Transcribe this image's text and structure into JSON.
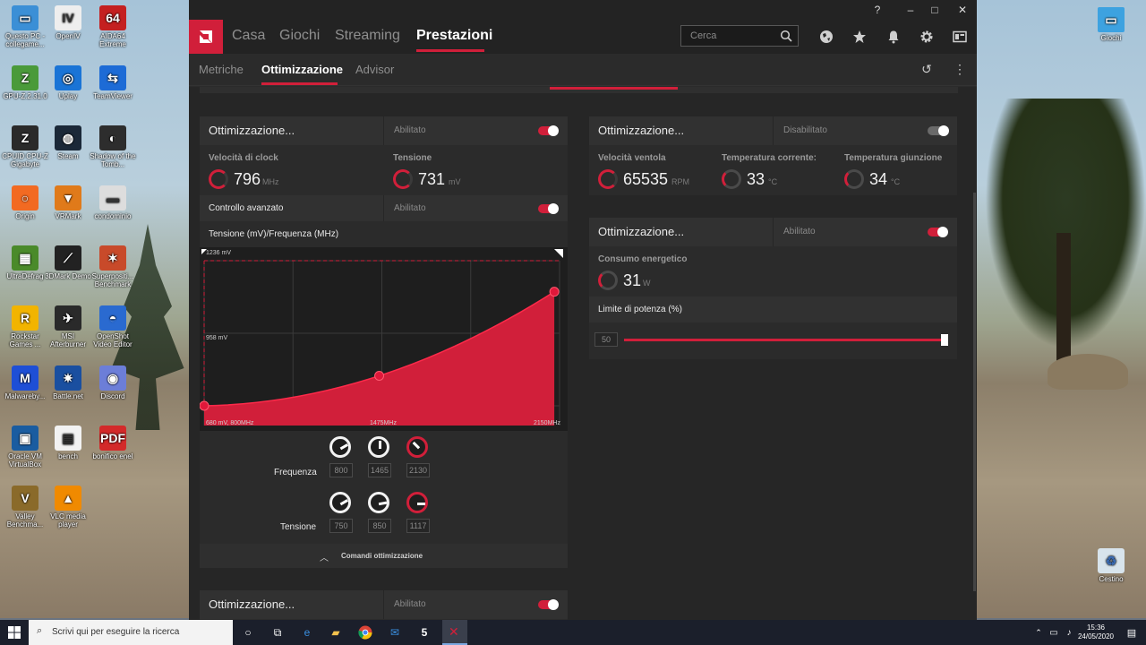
{
  "desktop": {
    "left_icons": [
      {
        "name": "questo-pc",
        "label": "Questo PC - collegame...",
        "color": "#3b8fd6",
        "glyph": "▭"
      },
      {
        "name": "openiv",
        "label": "OpenIV",
        "color": "#eeeeee",
        "glyph": "IV"
      },
      {
        "name": "aida64",
        "label": "AIDA64 Extreme",
        "color": "#c42020",
        "glyph": "64"
      },
      {
        "name": "gpu-z",
        "label": "GPU-Z.2.31.0",
        "color": "#4a9a3a",
        "glyph": "Z"
      },
      {
        "name": "uplay",
        "label": "Uplay",
        "color": "#1a74d6",
        "glyph": "◎"
      },
      {
        "name": "teamviewer",
        "label": "TeamViewer",
        "color": "#1d6bd6",
        "glyph": "⇆"
      },
      {
        "name": "cpuz",
        "label": "CPUID CPU-Z Gigabyte",
        "color": "#2a2a2a",
        "glyph": "Z"
      },
      {
        "name": "steam",
        "label": "Steam",
        "color": "#1b2838",
        "glyph": "◍"
      },
      {
        "name": "tomb-raider",
        "label": "Shadow of the Tomb...",
        "color": "#2d2d2d",
        "glyph": "◐"
      },
      {
        "name": "origin",
        "label": "Origin",
        "color": "#f26a22",
        "glyph": "○"
      },
      {
        "name": "vrmark",
        "label": "VRMark",
        "color": "#e07a1a",
        "glyph": "▼"
      },
      {
        "name": "condominio",
        "label": "condominio",
        "color": "#dddddd",
        "glyph": "▬"
      },
      {
        "name": "ultradefrag",
        "label": "UltraDefrag",
        "color": "#4a8a2a",
        "glyph": "▦"
      },
      {
        "name": "3dmark",
        "label": "3DMark Demo",
        "color": "#222222",
        "glyph": "⟋"
      },
      {
        "name": "superposition",
        "label": "Superpositi... Benchmark",
        "color": "#c84a2a",
        "glyph": "✶"
      },
      {
        "name": "rockstar",
        "label": "Rockstar Games ...",
        "color": "#f2b400",
        "glyph": "R"
      },
      {
        "name": "msi-afterburner",
        "label": "MSI Afterburner",
        "color": "#2a2a2a",
        "glyph": "✈"
      },
      {
        "name": "openshot",
        "label": "OpenShot Video Editor",
        "color": "#2a6ad0",
        "glyph": "◓"
      },
      {
        "name": "malwarebytes",
        "label": "Malwareby...",
        "color": "#1e4fd6",
        "glyph": "M"
      },
      {
        "name": "battlenet",
        "label": "Battle.net",
        "color": "#1a4fa0",
        "glyph": "✷"
      },
      {
        "name": "discord",
        "label": "Discord",
        "color": "#6c7ed8",
        "glyph": "◉"
      },
      {
        "name": "virtualbox",
        "label": "Oracle VM VirtualBox",
        "color": "#1a5ca0",
        "glyph": "▣"
      },
      {
        "name": "bench",
        "label": "bench",
        "color": "#f2f2f2",
        "glyph": "▤"
      },
      {
        "name": "bonifico",
        "label": "bonifico enel",
        "color": "#d32a2a",
        "glyph": "PDF"
      },
      {
        "name": "valley",
        "label": "Valley Benchma...",
        "color": "#8a6a2a",
        "glyph": "V"
      },
      {
        "name": "vlc",
        "label": "VLC media player",
        "color": "#f08a00",
        "glyph": "▲"
      }
    ],
    "right_icons": [
      {
        "name": "giochi-folder",
        "label": "Giochi"
      },
      {
        "name": "cestino",
        "label": "Cestino"
      }
    ]
  },
  "app": {
    "nav": {
      "items": [
        "Casa",
        "Giochi",
        "Streaming",
        "Prestazioni"
      ],
      "active": "Prestazioni"
    },
    "search_placeholder": "Cerca",
    "subnav": {
      "items": [
        "Metriche",
        "Ottimizzazione",
        "Advisor"
      ],
      "active": "Ottimizzazione"
    },
    "gpu_panel": {
      "title": "Ottimizzazione...",
      "state": "Abilitato",
      "enabled": true,
      "clock_label": "Velocità di clock",
      "clock_value": "796",
      "clock_unit": "MHz",
      "voltage_label": "Tensione",
      "voltage_value": "731",
      "voltage_unit": "mV",
      "advanced_label": "Controllo avanzato",
      "advanced_state": "Abilitato",
      "curve_label": "Tensione (mV)/Frequenza (MHz)",
      "chart_labels": {
        "top": "1236 mV",
        "mid": "958 mV",
        "bottom_left": "680 mV, 800MHz",
        "bottom_mid": "1475MHz",
        "bottom_right": "2150MHz"
      },
      "freq_label": "Frequenza",
      "freq_values": [
        "800",
        "1465",
        "2130"
      ],
      "volt_label": "Tensione",
      "volt_values": [
        "750",
        "850",
        "1117"
      ],
      "commands_label": "Comandi ottimizzazione"
    },
    "fan_panel": {
      "title": "Ottimizzazione...",
      "state": "Disabilitato",
      "enabled": false,
      "fan_label": "Velocità ventola",
      "fan_value": "65535",
      "fan_unit": "RPM",
      "temp_label": "Temperatura corrente:",
      "temp_value": "33",
      "temp_unit": "°C",
      "junction_label": "Temperatura giunzione",
      "junction_value": "34",
      "junction_unit": "°C"
    },
    "power_panel": {
      "title": "Ottimizzazione...",
      "state": "Abilitato",
      "enabled": true,
      "power_label": "Consumo energetico",
      "power_value": "31",
      "power_unit": "W",
      "limit_label": "Limite di potenza (%)",
      "limit_value": "50"
    },
    "mem_panel": {
      "title": "Ottimizzazione...",
      "state": "Abilitato"
    }
  },
  "taskbar": {
    "search_placeholder": "Scrivi qui per eseguire la ricerca",
    "time": "15:36",
    "date": "24/05/2020"
  },
  "chart_data": {
    "type": "area",
    "title": "Tensione (mV)/Frequenza (MHz)",
    "x": [
      800,
      1465,
      2130
    ],
    "y": [
      680,
      795,
      1117
    ],
    "xlim": [
      800,
      2150
    ],
    "ylim": [
      680,
      1236
    ],
    "ytick_labels": [
      "1236 mV",
      "958 mV",
      "680 mV"
    ],
    "xtick_labels": [
      "800MHz",
      "1475MHz",
      "2150MHz"
    ],
    "grid": true,
    "color": "#d11f3a"
  }
}
